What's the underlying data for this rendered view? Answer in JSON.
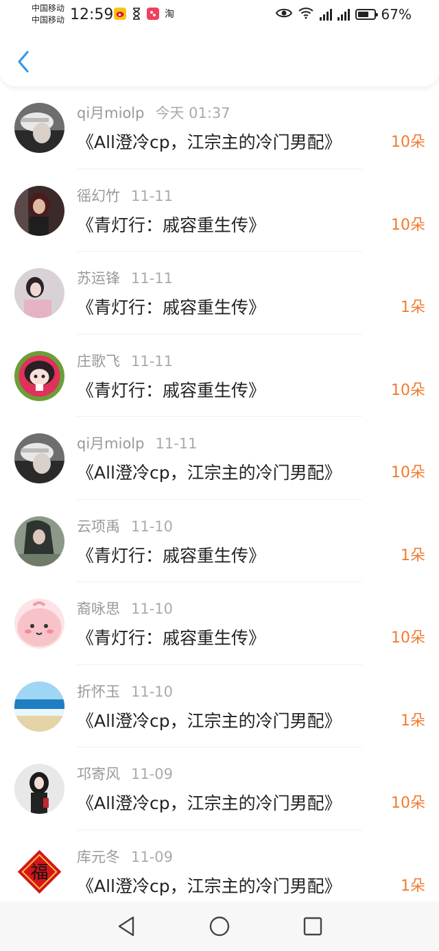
{
  "status_bar": {
    "carrier_1": "中国移动",
    "carrier_2": "中国移动",
    "time": "12:59",
    "app_icons": [
      "weibo-icon",
      "hourglass-icon",
      "app-icon",
      "taobao-icon"
    ],
    "taobao_text": "淘",
    "battery_percent": "67%",
    "battery_level": 0.67,
    "network_1": "4G",
    "network_2": "4G"
  },
  "header": {
    "back_icon": "chevron-left-icon",
    "accent_color": "#2b9af3"
  },
  "colors": {
    "gift_color": "#f07b2f",
    "name_color": "#999999"
  },
  "gifts": [
    {
      "name": "qi月miolp",
      "time": "今天 01:37",
      "book": "《All澄冷cp，江宗主的冷门男配》",
      "amount": "10朵"
    },
    {
      "name": "徭幻竹",
      "time": "11-11",
      "book": "《青灯行：戚容重生传》",
      "amount": "10朵"
    },
    {
      "name": "苏运锋",
      "time": "11-11",
      "book": "《青灯行：戚容重生传》",
      "amount": "1朵"
    },
    {
      "name": "庄歌飞",
      "time": "11-11",
      "book": "《青灯行：戚容重生传》",
      "amount": "10朵"
    },
    {
      "name": "qi月miolp",
      "time": "11-11",
      "book": "《All澄冷cp，江宗主的冷门男配》",
      "amount": "10朵"
    },
    {
      "name": "云项禹",
      "time": "11-10",
      "book": "《青灯行：戚容重生传》",
      "amount": "1朵"
    },
    {
      "name": "裔咏思",
      "time": "11-10",
      "book": "《青灯行：戚容重生传》",
      "amount": "10朵"
    },
    {
      "name": "折怀玉",
      "time": "11-10",
      "book": "《All澄冷cp，江宗主的冷门男配》",
      "amount": "1朵"
    },
    {
      "name": "邛寄风",
      "time": "11-09",
      "book": "《All澄冷cp，江宗主的冷门男配》",
      "amount": "10朵"
    },
    {
      "name": "库元冬",
      "time": "11-09",
      "book": "《All澄冷cp，江宗主的冷门男配》",
      "amount": "1朵"
    }
  ],
  "nav": {
    "back_icon": "triangle-back-icon",
    "home_icon": "circle-home-icon",
    "recent_icon": "square-recents-icon"
  }
}
